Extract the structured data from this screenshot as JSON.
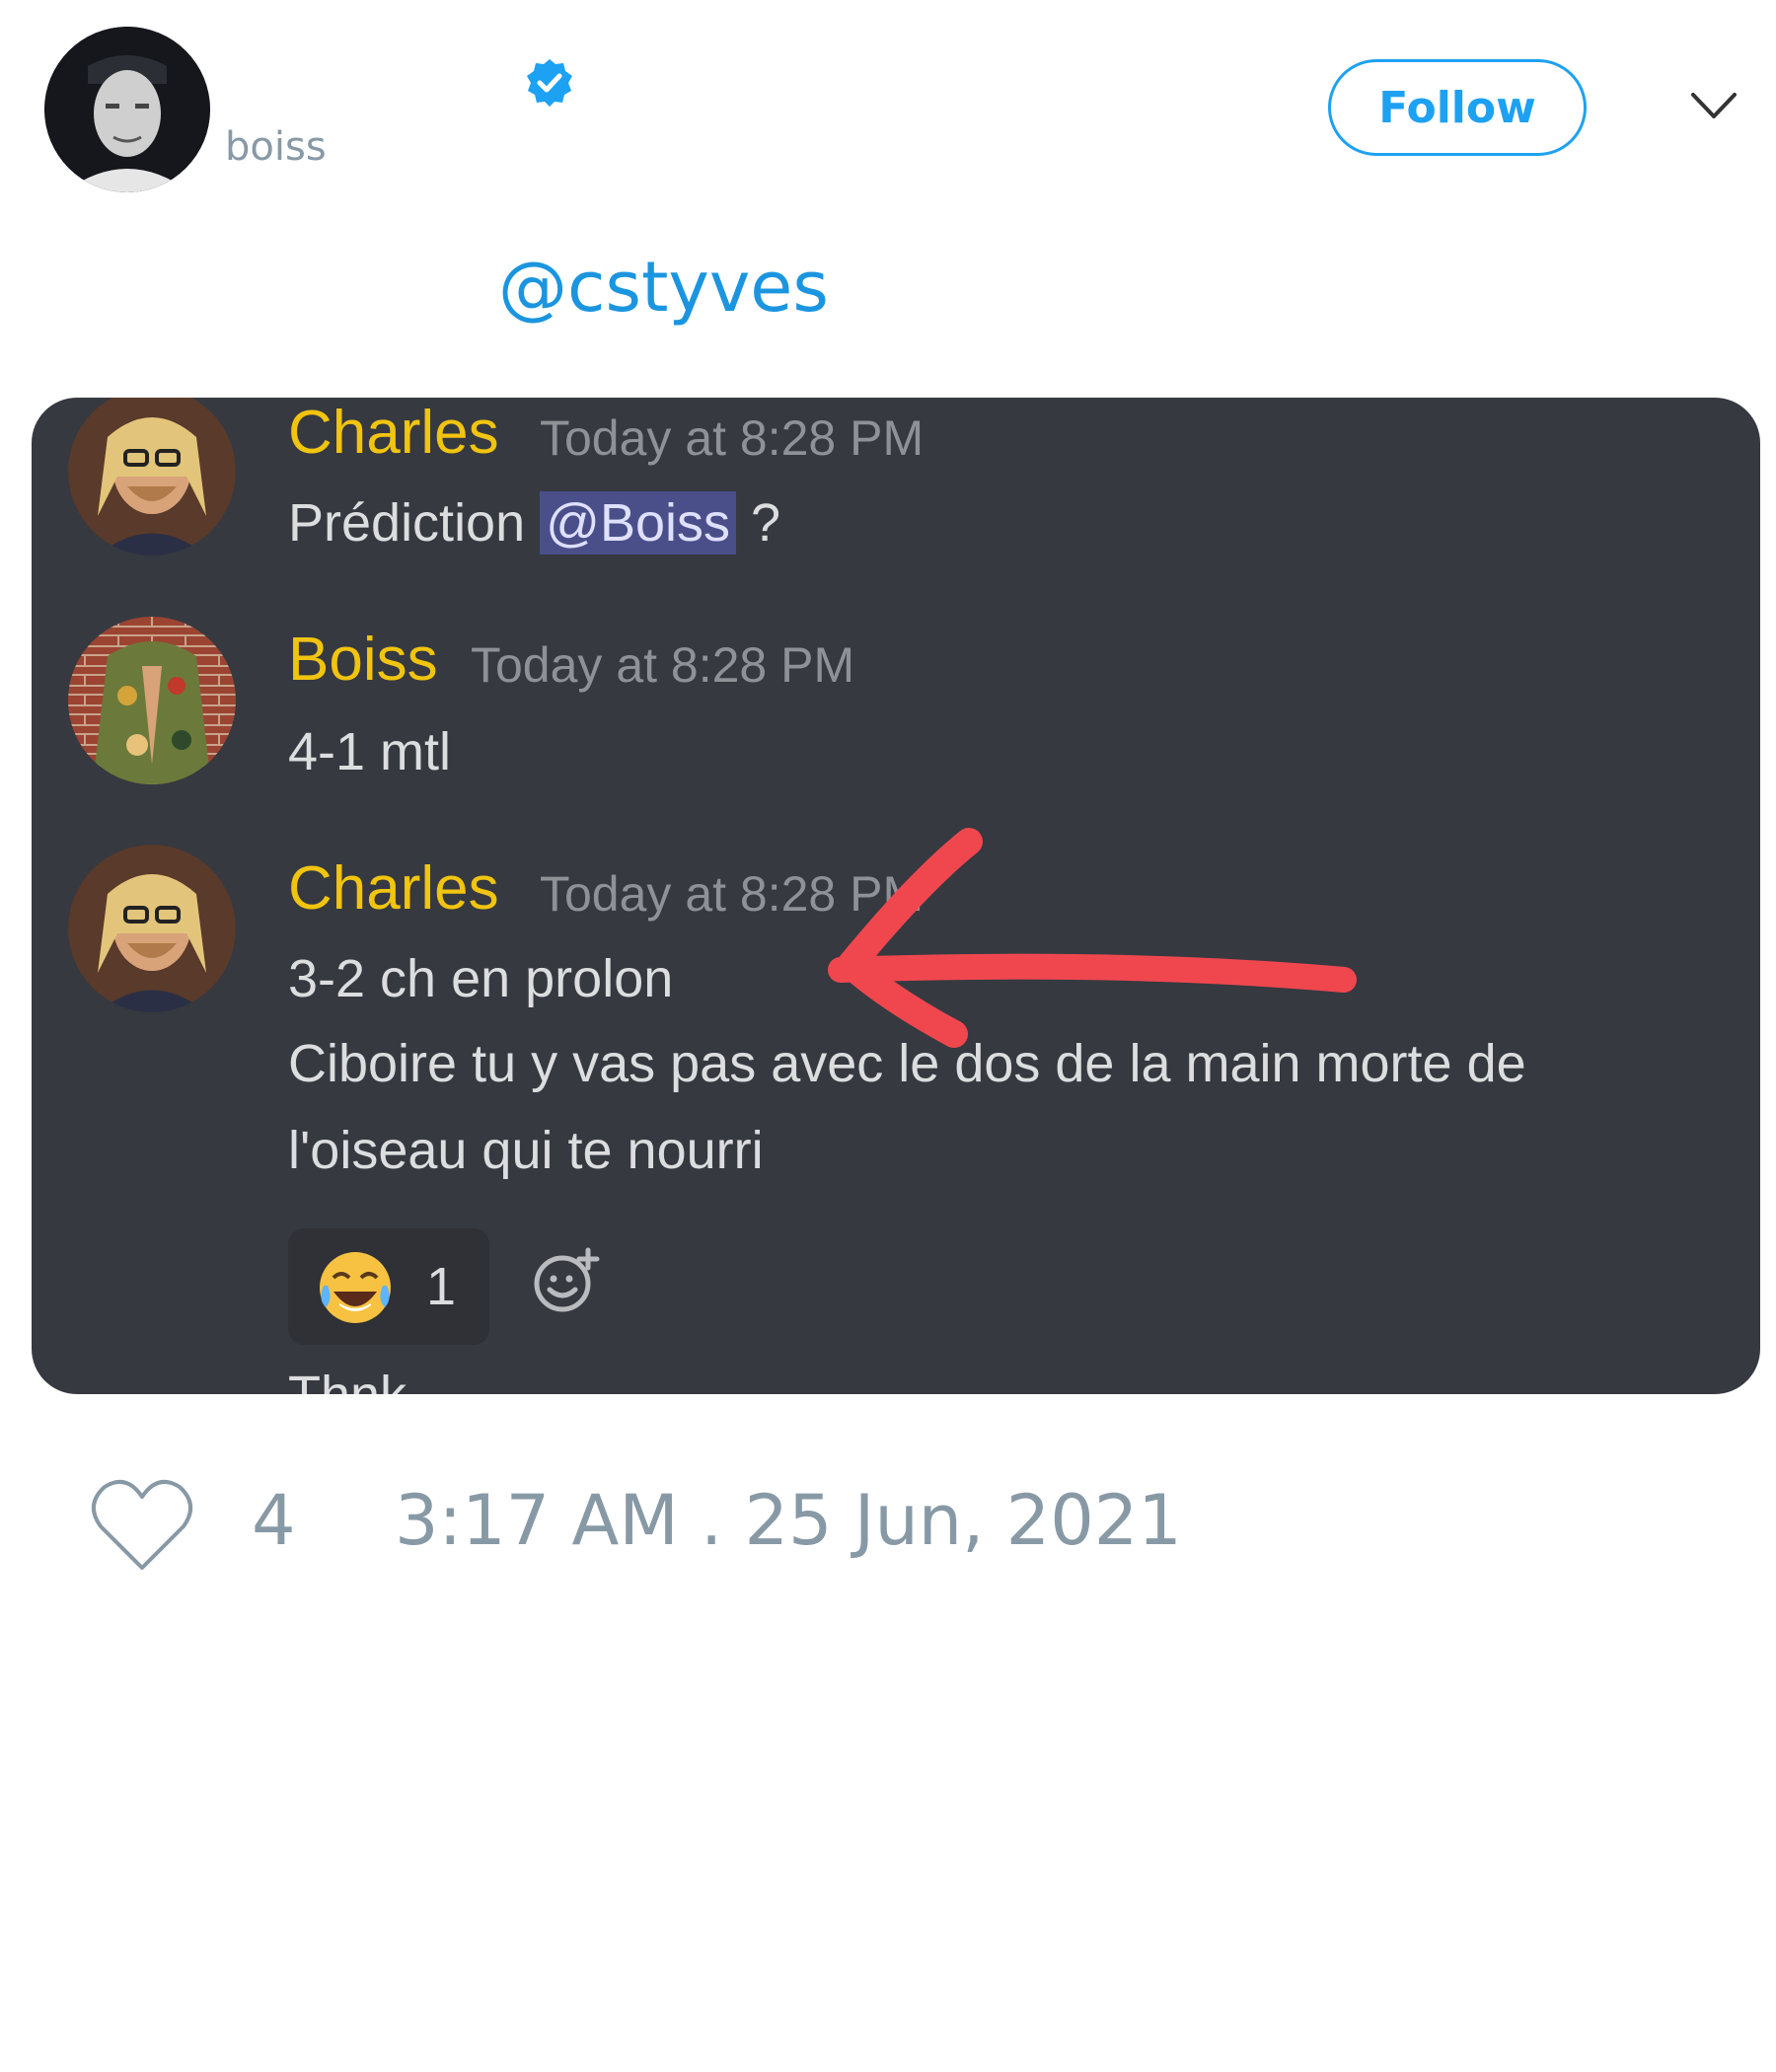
{
  "header": {
    "handle": "boiss",
    "follow_label": "Follow",
    "avatar_icon": "user-avatar",
    "verified_icon": "verified-badge-icon",
    "menu_icon": "chevron-down-icon"
  },
  "tweet": {
    "text": "@cstyves",
    "like_count": "4",
    "timestamp": "3:17 AM . 25 Jun, 2021"
  },
  "media": {
    "messages": [
      {
        "author": "Charles",
        "time": "Today at 8:28 PM",
        "text_before": "Prédiction ",
        "mention": "@Boiss",
        "text_after": " ?"
      },
      {
        "author": "Boiss",
        "time": "Today at 8:28 PM",
        "text": "4-1 mtl"
      },
      {
        "author": "Charles",
        "time": "Today at 8:28 PM",
        "line1": "3-2 ch en prolon",
        "line2": "Ciboire tu y vas pas avec le dos de la main morte de",
        "line3": "l'oiseau qui te nourri"
      }
    ],
    "reaction": {
      "emoji": "😂",
      "count": "1",
      "add_icon": "add-reaction-icon"
    },
    "cut_off_text": "Thnk"
  },
  "colors": {
    "accent": "#1da1f2",
    "discord_bg": "#363940",
    "username": "#f1c40f",
    "arrow": "#f0474f"
  }
}
